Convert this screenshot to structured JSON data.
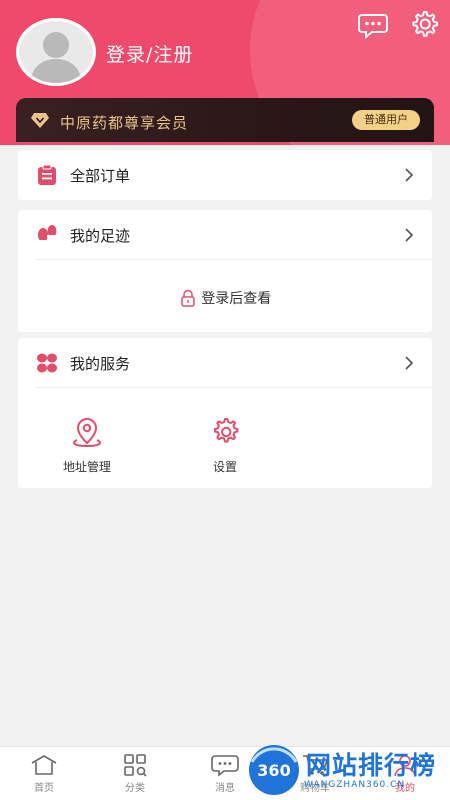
{
  "header": {
    "login_text": "登录/注册",
    "accent_color": "#ef4a6c"
  },
  "vip_bar": {
    "title": "中原药都尊享会员",
    "badge": "普通用户"
  },
  "menu": {
    "orders_label": "全部订单",
    "footprint_label": "我的足迹",
    "footprint_locked_text": "登录后查看",
    "services_label": "我的服务"
  },
  "services": [
    {
      "label": "地址管理",
      "icon": "location-pin-icon"
    },
    {
      "label": "设置",
      "icon": "gear-icon"
    }
  ],
  "tabbar": {
    "items": [
      {
        "label": "首页",
        "icon": "home-icon"
      },
      {
        "label": "分类",
        "icon": "category-grid-icon"
      },
      {
        "label": "消息",
        "icon": "message-icon"
      },
      {
        "label": "购物车",
        "icon": "cart-icon"
      },
      {
        "label": "我的",
        "icon": "profile-icon",
        "active": true
      }
    ]
  },
  "watermark": {
    "logo_number": "360",
    "text": "网站排行榜",
    "sub": "WANGZHAN360.CN"
  }
}
